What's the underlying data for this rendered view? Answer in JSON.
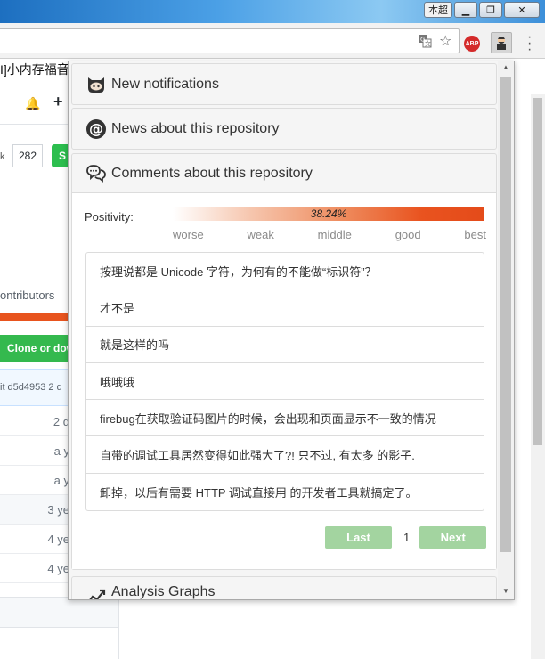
{
  "window": {
    "user_label": "本超",
    "minimize_glyph": "▁",
    "maximize_glyph": "❐",
    "close_glyph": "✕"
  },
  "toolbar": {
    "translate_icon": "translate-icon",
    "star_glyph": "☆",
    "abp_label": "ABP",
    "menu_glyph": "⋮"
  },
  "background_page": {
    "tab_title": "I]小内存福音",
    "count": "282",
    "k_text": "k",
    "star_button_text": "S",
    "contributors_text": "ontributors",
    "clone_text": "Clone or dow",
    "commit_text": "it d5d4953  2 d",
    "file_ages": [
      "2 d",
      "a y",
      "a y",
      "3 ye",
      "4 ye",
      "4 ye"
    ]
  },
  "popup": {
    "panels": {
      "notifications": {
        "title": "New notifications",
        "icon": "octocat-icon"
      },
      "news": {
        "title": "News about this repository",
        "icon": "at-sign-icon"
      },
      "comments": {
        "title": "Comments about this repository",
        "icon": "speech-bubbles-icon"
      },
      "graphs": {
        "title": "Analysis Graphs",
        "icon": "chart-icon"
      }
    },
    "positivity": {
      "label": "Positivity:",
      "value_text": "38.24%",
      "value": 38.24,
      "scale": [
        "worse",
        "weak",
        "middle",
        "good",
        "best"
      ],
      "gradient_colors": [
        "#ffffff",
        "#f6c6ae",
        "#ee8a5c",
        "#e9531f"
      ]
    },
    "comments": [
      "按理说都是 Unicode 字符，为何有的不能做“标识符”？",
      "才不是",
      "就是这样的吗",
      "哦哦哦",
      "firebug在获取验证码图片的时候，会出现和页面显示不一致的情况",
      "自带的调试工具居然变得如此强大了?! 只不过, 有太多 的影子.",
      "卸掉，以后有需要 HTTP 调试直接用 的开发者工具就搞定了。"
    ],
    "pager": {
      "last_label": "Last",
      "page": "1",
      "next_label": "Next",
      "button_color": "#a3d4a0"
    }
  },
  "colors": {
    "accent_orange": "#e8541e",
    "github_green": "#2cbe4e"
  }
}
